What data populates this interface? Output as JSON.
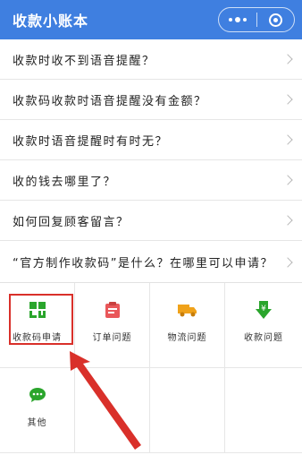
{
  "header": {
    "title": "收款小账本",
    "more_icon": "more-dots-icon",
    "close_icon": "target-icon",
    "color": "#3f7fe0"
  },
  "faq": [
    {
      "question": "收款时收不到语音提醒？"
    },
    {
      "question": "收款码收款时语音提醒没有金额？"
    },
    {
      "question": "收款时语音提醒时有时无？"
    },
    {
      "question": "收的钱去哪里了？"
    },
    {
      "question": "如何回复顾客留言？"
    },
    {
      "question": "“官方制作收款码”是什么？在哪里可以申请？"
    }
  ],
  "categories": [
    {
      "label": "收款码申请",
      "icon": "qr-code-icon",
      "color": "#2aa52c"
    },
    {
      "label": "订单问题",
      "icon": "clipboard-icon",
      "color": "#e9575a"
    },
    {
      "label": "物流问题",
      "icon": "truck-icon",
      "color": "#f0a21a"
    },
    {
      "label": "收款问题",
      "icon": "yuan-download-icon",
      "color": "#2aa52c"
    },
    {
      "label": "其他",
      "icon": "chat-bubble-icon",
      "color": "#2aa52c"
    }
  ],
  "annotation": {
    "color": "#d9302a"
  }
}
